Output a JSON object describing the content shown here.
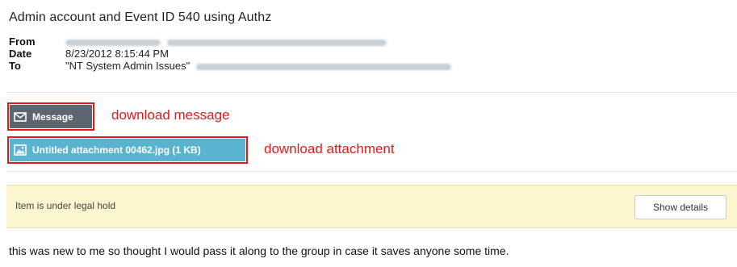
{
  "email": {
    "subject": "Admin account and Event ID 540 using Authz",
    "from_label": "From",
    "date_label": "Date",
    "to_label": "To",
    "date_value": "8/23/2012 8:15:44 PM",
    "to_name": "\"NT System Admin Issues\""
  },
  "buttons": {
    "message_label": "Message",
    "attachment_label": "Untitled attachment 00462.jpg (1 KB)"
  },
  "annotations": {
    "download_message": "download message",
    "download_attachment": "download attachment"
  },
  "legal_hold": {
    "text": "Item is under legal hold",
    "show_details_label": "Show details"
  },
  "body": {
    "text": "this was new to me so thought I would pass it along to the group in case it saves anyone some time."
  },
  "icons": {
    "message": "envelope-icon",
    "attachment": "image-icon"
  },
  "colors": {
    "annotation_red": "#e4181c",
    "message_button": "#5c6670",
    "attachment_button": "#5ab4d0",
    "legal_hold_bg": "#fcf6d0"
  }
}
